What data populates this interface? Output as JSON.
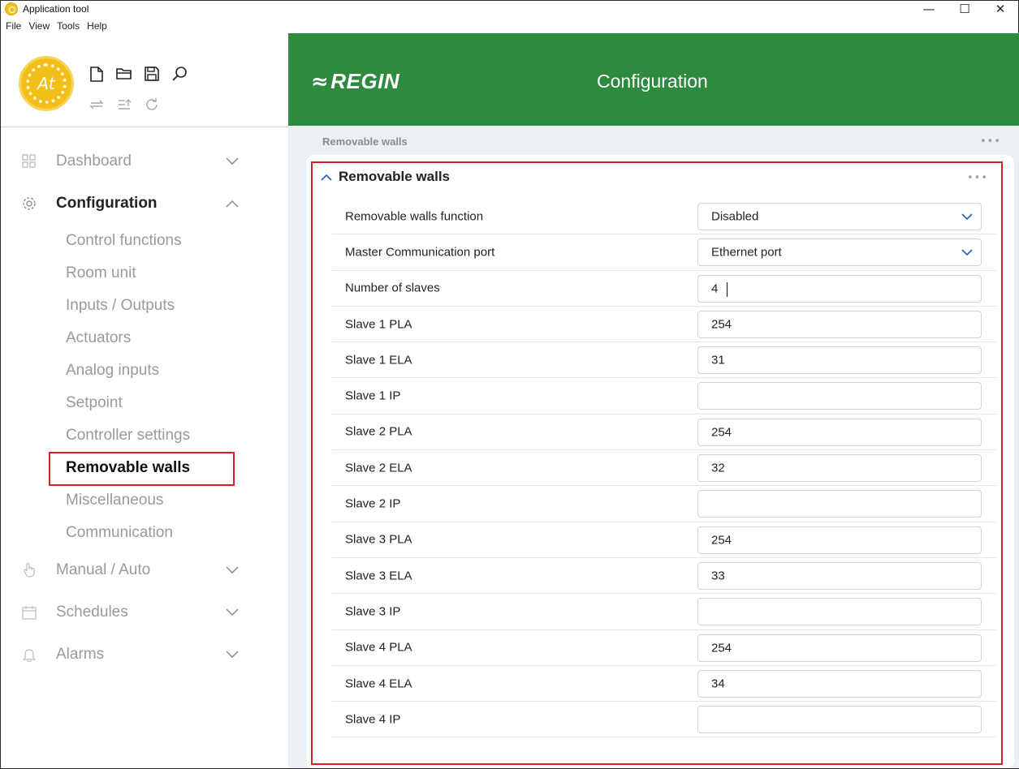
{
  "window": {
    "title": "Application tool",
    "controls": {
      "minimize": "—",
      "maximize": "☐",
      "close": "✕"
    }
  },
  "menu": [
    "File",
    "View",
    "Tools",
    "Help"
  ],
  "toolbar": {
    "row1": [
      "new-file-icon",
      "open-folder-icon",
      "save-icon",
      "search-icon"
    ],
    "row2": [
      "sync-icon",
      "upload-list-icon",
      "refresh-icon"
    ]
  },
  "nav": {
    "dashboard": "Dashboard",
    "configuration": "Configuration",
    "sub_items": [
      "Control functions",
      "Room unit",
      "Inputs / Outputs",
      "Actuators",
      "Analog inputs",
      "Setpoint",
      "Controller settings",
      "Removable walls",
      "Miscellaneous",
      "Communication"
    ],
    "selected_sub": "Removable walls",
    "manual_auto": "Manual / Auto",
    "schedules": "Schedules",
    "alarms": "Alarms"
  },
  "header": {
    "brand": "REGIN",
    "title": "Configuration",
    "color": "#2d8a3e"
  },
  "breadcrumb": "Removable walls",
  "section": {
    "title": "Removable walls",
    "rows": [
      {
        "label": "Removable walls function",
        "value": "Disabled",
        "type": "select"
      },
      {
        "label": "Master Communication port",
        "value": "Ethernet port",
        "type": "select"
      },
      {
        "label": "Number of slaves",
        "value": "4",
        "type": "input"
      },
      {
        "label": "Slave 1 PLA",
        "value": "254",
        "type": "input"
      },
      {
        "label": "Slave 1 ELA",
        "value": "31",
        "type": "input"
      },
      {
        "label": "Slave 1 IP",
        "value": "",
        "type": "input"
      },
      {
        "label": "Slave 2 PLA",
        "value": "254",
        "type": "input"
      },
      {
        "label": "Slave 2 ELA",
        "value": "32",
        "type": "input"
      },
      {
        "label": "Slave 2 IP",
        "value": "",
        "type": "input"
      },
      {
        "label": "Slave 3 PLA",
        "value": "254",
        "type": "input"
      },
      {
        "label": "Slave 3 ELA",
        "value": "33",
        "type": "input"
      },
      {
        "label": "Slave 3 IP",
        "value": "",
        "type": "input"
      },
      {
        "label": "Slave 4 PLA",
        "value": "254",
        "type": "input"
      },
      {
        "label": "Slave 4 ELA",
        "value": "34",
        "type": "input"
      },
      {
        "label": "Slave 4 IP",
        "value": "",
        "type": "input"
      }
    ]
  },
  "colors": {
    "highlight": "#d4222a",
    "header_green": "#2d8a3e",
    "logo_yellow": "#f2be1a"
  }
}
